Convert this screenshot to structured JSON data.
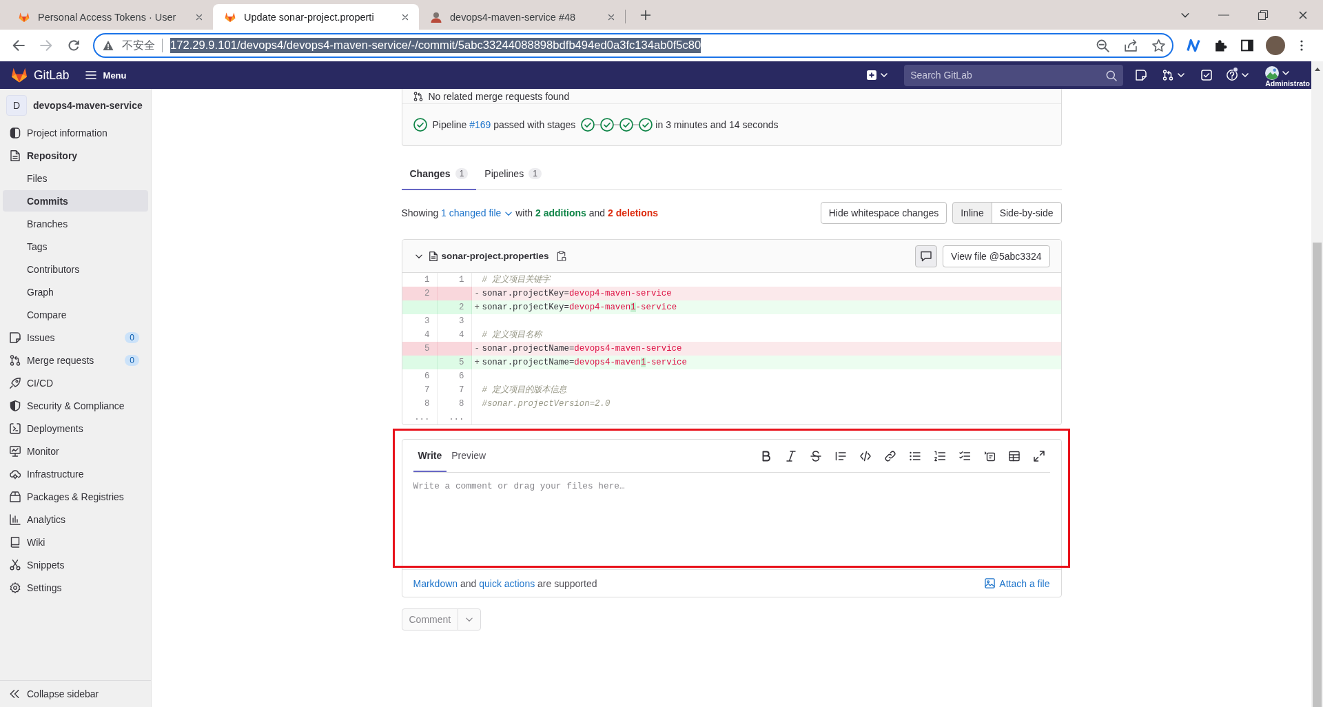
{
  "browser": {
    "tabs": [
      {
        "title": "Personal Access Tokens · User",
        "kind": "gitlab",
        "selected": false
      },
      {
        "title": "Update sonar-project.properti",
        "kind": "gitlab",
        "selected": true
      },
      {
        "title": "devops4-maven-service #48",
        "kind": "person",
        "selected": false
      }
    ],
    "address": {
      "security": "不安全",
      "url": "172.29.9.101/devops4/devops4-maven-service/-/commit/5abc33244088898bdfb494ed0a3fc134ab0f5c80",
      "selected": true
    }
  },
  "header": {
    "brand": "GitLab",
    "menu": "Menu",
    "search": {
      "placeholder": "Search GitLab"
    },
    "help_dot": true,
    "user": "Administrato"
  },
  "sidebar": {
    "project": {
      "avatar": "D",
      "name": "devops4-maven-service"
    },
    "items": [
      {
        "label": "Project information",
        "expanded": false
      },
      {
        "label": "Repository",
        "expanded": true,
        "children": [
          {
            "label": "Files",
            "selected": false
          },
          {
            "label": "Commits",
            "selected": true
          },
          {
            "label": "Branches",
            "selected": false
          },
          {
            "label": "Tags",
            "selected": false
          },
          {
            "label": "Contributors",
            "selected": false
          },
          {
            "label": "Graph",
            "selected": false
          },
          {
            "label": "Compare",
            "selected": false
          }
        ]
      },
      {
        "label": "Issues",
        "expanded": false,
        "count": "0"
      },
      {
        "label": "Merge requests",
        "expanded": false,
        "count": "0"
      },
      {
        "label": "CI/CD",
        "expanded": false
      },
      {
        "label": "Security & Compliance",
        "expanded": false
      },
      {
        "label": "Deployments",
        "expanded": false
      },
      {
        "label": "Monitor",
        "expanded": false
      },
      {
        "label": "Infrastructure",
        "expanded": false
      },
      {
        "label": "Packages & Registries",
        "expanded": false
      },
      {
        "label": "Analytics",
        "expanded": false
      },
      {
        "label": "Wiki",
        "expanded": false
      },
      {
        "label": "Snippets",
        "expanded": false
      },
      {
        "label": "Settings",
        "expanded": false
      }
    ],
    "collapse": "Collapse sidebar"
  },
  "commit": {
    "related": "No related merge requests found",
    "pipeline": {
      "passed": true,
      "label": "Pipeline",
      "id": "#169",
      "text": "passed with stages",
      "stages": [
        {
          "passed": true
        },
        {
          "passed": true
        },
        {
          "passed": true
        },
        {
          "passed": true
        }
      ],
      "duration": "in 3 minutes and 14 seconds"
    },
    "tabs": [
      {
        "label": "Changes",
        "count": "1",
        "selected": true
      },
      {
        "label": "Pipelines",
        "count": "1",
        "selected": false
      }
    ],
    "summary": [
      {
        "text": "Showing",
        "kind": "text"
      },
      {
        "text": "1 changed file",
        "kind": "dropdown"
      },
      {
        "text": "with",
        "kind": "text"
      },
      {
        "text": "2 additions",
        "kind": "addition"
      },
      {
        "text": "and",
        "kind": "text"
      },
      {
        "text": "2 deletions",
        "kind": "deletion"
      }
    ],
    "whitespace_button": "Hide whitespace changes",
    "view_modes": [
      {
        "label": "Inline",
        "selected": true
      },
      {
        "label": "Side-by-side",
        "selected": false
      }
    ],
    "file": {
      "name": "sonar-project.properties",
      "expanded": true,
      "view_file": "View file @5abc3324",
      "lines": [
        {
          "kind": "context",
          "old": "1",
          "new": "1",
          "tokens": [
            {
              "text": "# 定义项目关键字",
              "kind": "comment"
            }
          ]
        },
        {
          "kind": "deletion",
          "old": "2",
          "sign": "-",
          "tokens": [
            {
              "text": "sonar.projectKey=",
              "kind": "plain"
            },
            {
              "text": "devop4-maven-service",
              "kind": "string"
            }
          ]
        },
        {
          "kind": "addition",
          "new": "2",
          "sign": "+",
          "tokens": [
            {
              "text": "sonar.projectKey=",
              "kind": "plain"
            },
            {
              "text": "devop4-maven",
              "kind": "string"
            },
            {
              "text": "1",
              "kind": "inserted"
            },
            {
              "text": "-service",
              "kind": "string"
            }
          ]
        },
        {
          "kind": "context",
          "old": "3",
          "new": "3"
        },
        {
          "kind": "context",
          "old": "4",
          "new": "4",
          "tokens": [
            {
              "text": "# 定义项目名称",
              "kind": "comment"
            }
          ]
        },
        {
          "kind": "deletion",
          "old": "5",
          "sign": "-",
          "tokens": [
            {
              "text": "sonar.projectName=",
              "kind": "plain"
            },
            {
              "text": "devops4-maven-service",
              "kind": "string"
            }
          ]
        },
        {
          "kind": "addition",
          "new": "5",
          "sign": "+",
          "tokens": [
            {
              "text": "sonar.projectName=",
              "kind": "plain"
            },
            {
              "text": "devops4-maven",
              "kind": "string"
            },
            {
              "text": "1",
              "kind": "inserted"
            },
            {
              "text": "-service",
              "kind": "string"
            }
          ]
        },
        {
          "kind": "context",
          "old": "6",
          "new": "6"
        },
        {
          "kind": "context",
          "old": "7",
          "new": "7",
          "tokens": [
            {
              "text": "# 定义项目的版本信息",
              "kind": "comment"
            }
          ]
        },
        {
          "kind": "context",
          "old": "8",
          "new": "8",
          "tokens": [
            {
              "text": "#sonar.projectVersion=2.0",
              "kind": "comment"
            }
          ]
        },
        {
          "kind": "expander",
          "old": "...",
          "new": "..."
        }
      ]
    },
    "comment_form": {
      "tabs": [
        {
          "label": "Write",
          "selected": true
        },
        {
          "label": "Preview",
          "selected": false
        }
      ],
      "placeholder": "Write a comment or drag your files here…",
      "help": [
        {
          "text": "Markdown",
          "kind": "link"
        },
        {
          "text": "and",
          "kind": "text"
        },
        {
          "text": "quick actions",
          "kind": "link"
        },
        {
          "text": "are supported",
          "kind": "text"
        }
      ],
      "attach": "Attach a file",
      "submit": {
        "label": "Comment",
        "disabled": true
      },
      "highlight_box": true
    }
  }
}
